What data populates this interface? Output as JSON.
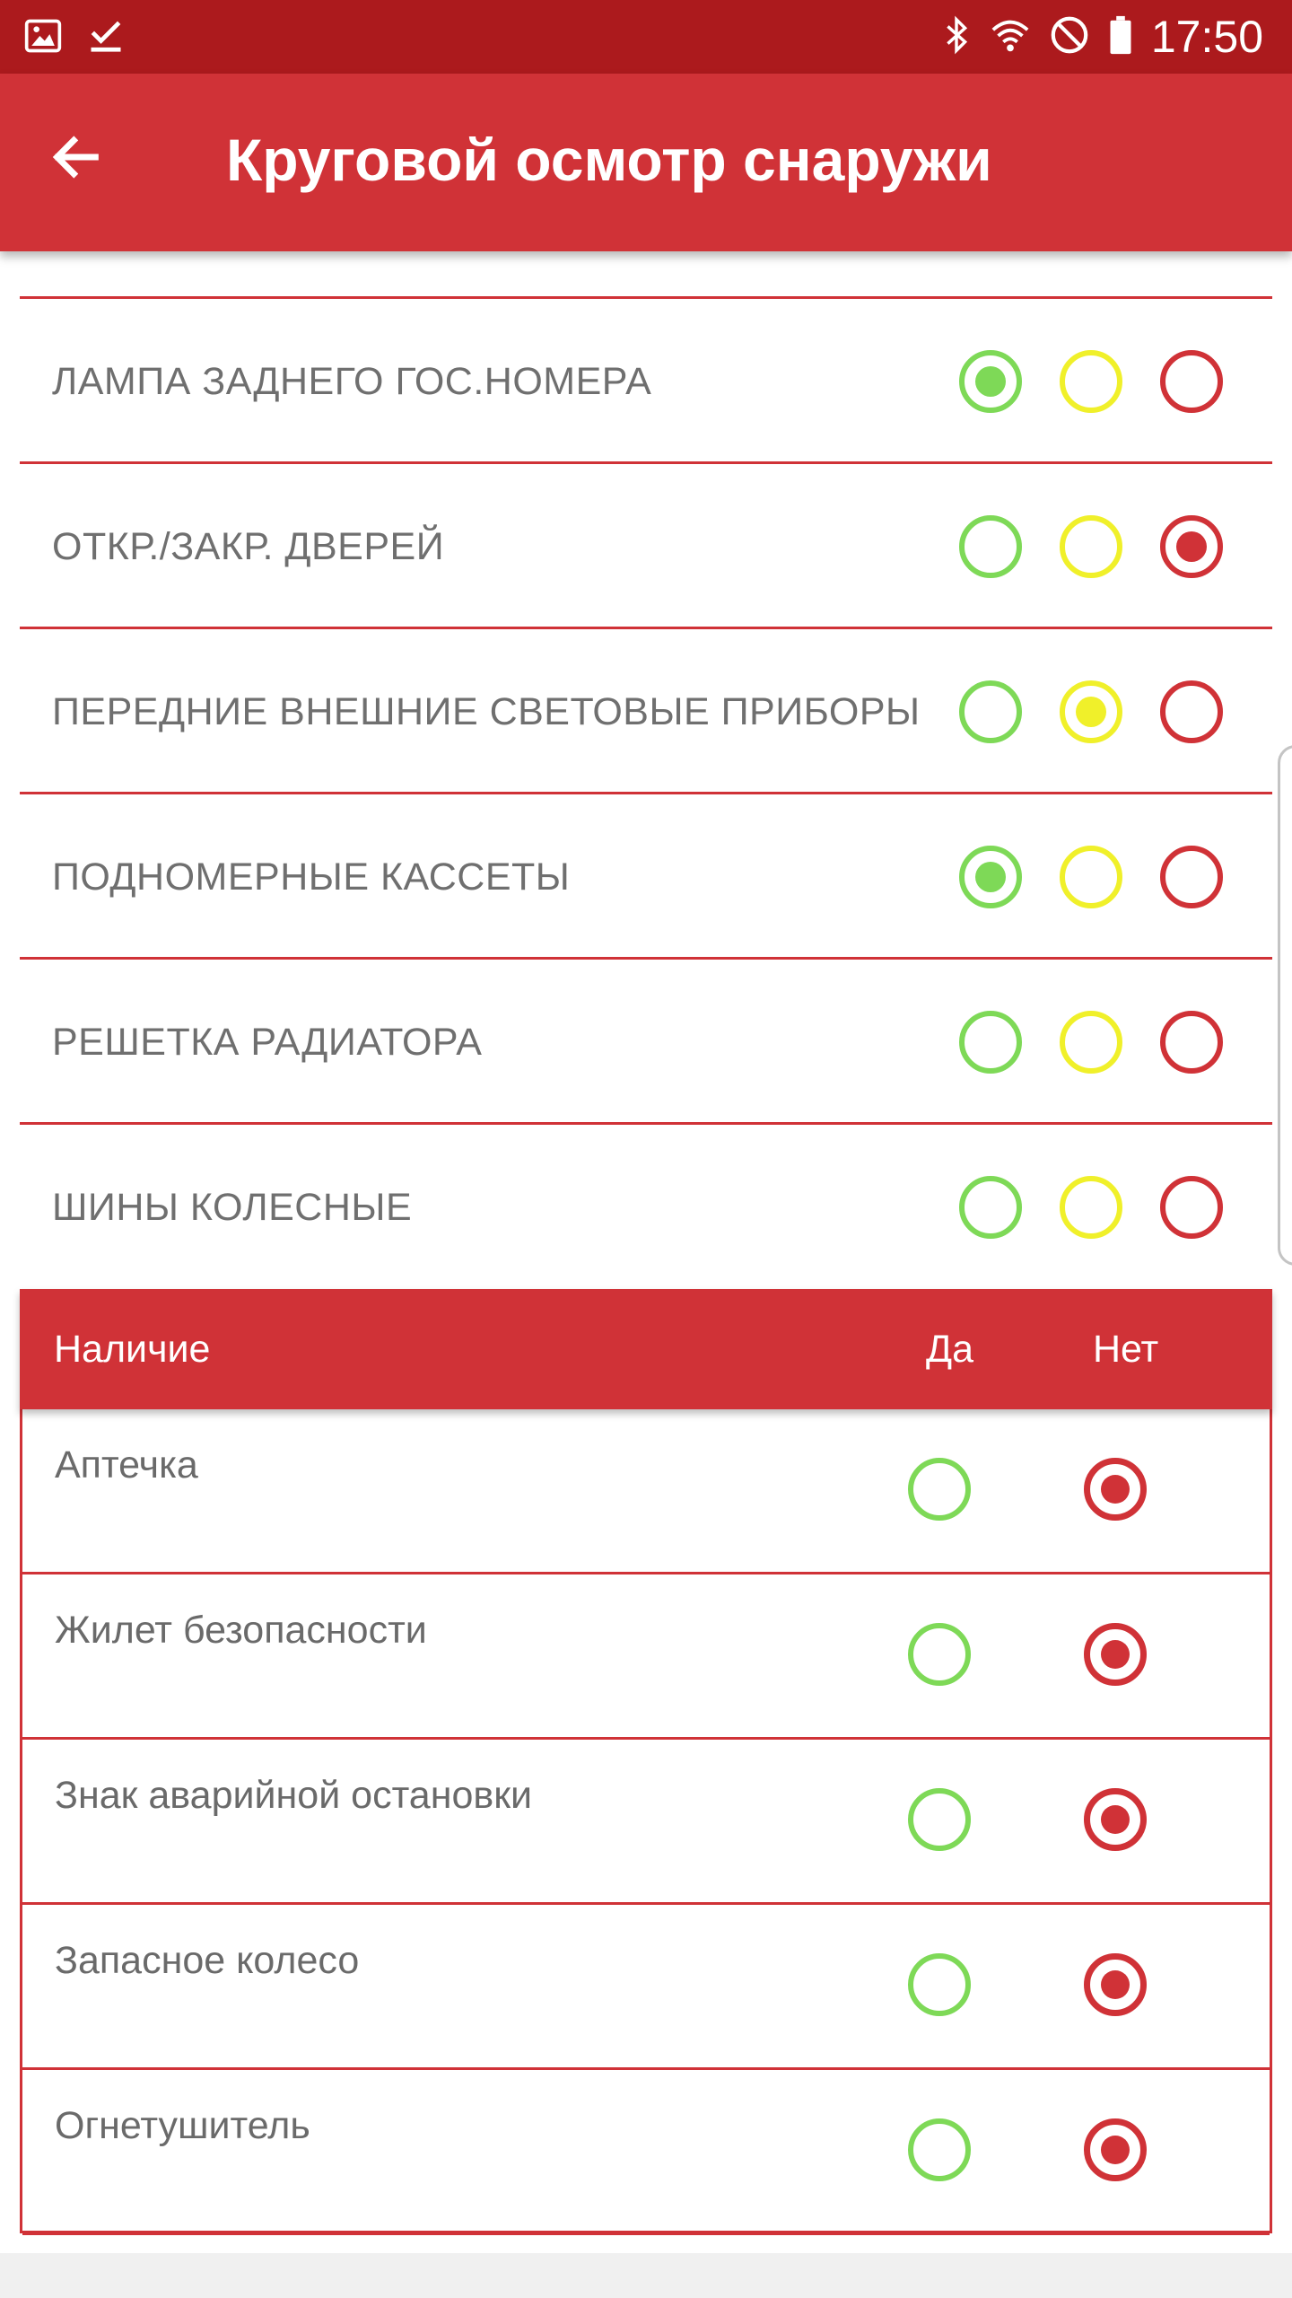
{
  "status_bar": {
    "time": "17:50",
    "left_icons": [
      "image-icon",
      "check-download-icon"
    ],
    "right_icons": [
      "bluetooth-icon",
      "wifi-icon",
      "do-not-disturb-icon",
      "battery-icon"
    ]
  },
  "app_bar": {
    "back_icon": "arrow-left-icon",
    "title": "Круговой осмотр снаружи",
    "color": "#d03237"
  },
  "inspection": {
    "options": [
      "ok",
      "warning",
      "fault"
    ],
    "option_colors": {
      "ok": "#7ed957",
      "warning": "#f0f02a",
      "fault": "#d03237"
    },
    "items": [
      {
        "label": "ЛАМПА ЗАДНЕГО ГОС.НОМЕРА",
        "selected": "ok"
      },
      {
        "label": "ОТКР./ЗАКР. ДВЕРЕЙ",
        "selected": "fault"
      },
      {
        "label": "ПЕРЕДНИЕ ВНЕШНИЕ СВЕТОВЫЕ ПРИБОРЫ",
        "selected": "warning"
      },
      {
        "label": "ПОДНОМЕРНЫЕ КАССЕТЫ",
        "selected": "ok"
      },
      {
        "label": "РЕШЕТКА РАДИАТОРА",
        "selected": null
      },
      {
        "label": "ШИНЫ КОЛЕСНЫЕ",
        "selected": null
      }
    ]
  },
  "presence": {
    "header": {
      "title": "Наличие",
      "yes": "Да",
      "no": "Нет"
    },
    "items": [
      {
        "label": "Аптечка",
        "selected": "no"
      },
      {
        "label": "Жилет безопасности",
        "selected": "no"
      },
      {
        "label": "Знак аварийной остановки",
        "selected": "no"
      },
      {
        "label": "Запасное колесо",
        "selected": "no"
      },
      {
        "label": "Огнетушитель",
        "selected": "no"
      }
    ]
  }
}
